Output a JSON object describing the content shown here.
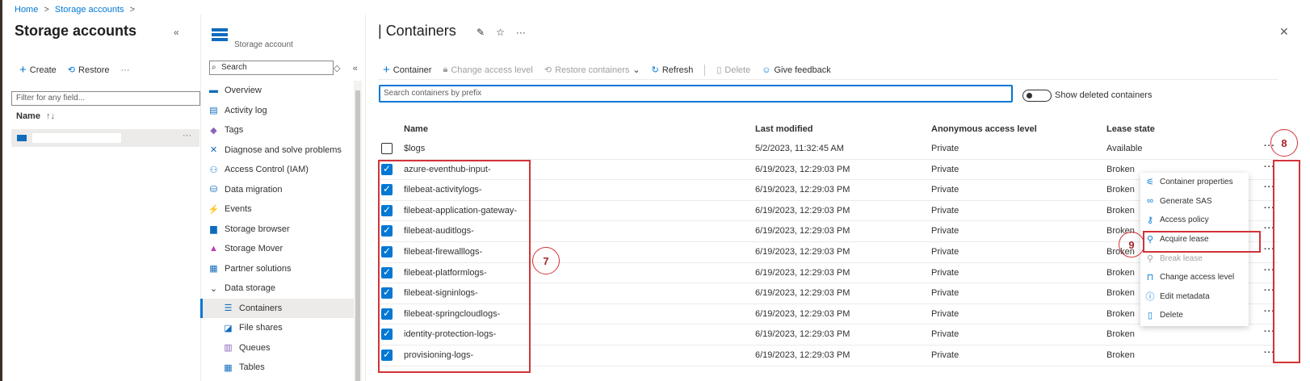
{
  "breadcrumb": {
    "home": "Home",
    "sep": ">",
    "storage": "Storage accounts"
  },
  "left_pane": {
    "title": "Storage accounts",
    "collapse": "«",
    "create": "Create",
    "restore": "Restore",
    "more": "···",
    "filter_placeholder": "Filter for any field...",
    "name_header": "Name",
    "sort": "↑↓",
    "row_dots": "···"
  },
  "resource": {
    "type_label": "Storage account",
    "search_placeholder": "Search"
  },
  "menu": {
    "items": [
      {
        "label": "Overview",
        "icon": "overview-icon"
      },
      {
        "label": "Activity log",
        "icon": "activity-log-icon"
      },
      {
        "label": "Tags",
        "icon": "tag-icon"
      },
      {
        "label": "Diagnose and solve problems",
        "icon": "wrench-icon"
      },
      {
        "label": "Access Control (IAM)",
        "icon": "people-icon"
      },
      {
        "label": "Data migration",
        "icon": "migration-icon"
      },
      {
        "label": "Events",
        "icon": "lightning-icon"
      },
      {
        "label": "Storage browser",
        "icon": "folder-icon"
      },
      {
        "label": "Storage Mover",
        "icon": "mover-icon"
      },
      {
        "label": "Partner solutions",
        "icon": "partner-icon"
      },
      {
        "label": "Data storage",
        "icon": "chevron-down-icon"
      },
      {
        "label": "Containers",
        "icon": "containers-icon"
      },
      {
        "label": "File shares",
        "icon": "file-shares-icon"
      },
      {
        "label": "Queues",
        "icon": "queues-icon"
      },
      {
        "label": "Tables",
        "icon": "tables-icon"
      }
    ]
  },
  "main": {
    "title": "Containers",
    "toolbar": {
      "container": "Container",
      "change_access": "Change access level",
      "restore": "Restore containers",
      "refresh": "Refresh",
      "delete": "Delete",
      "feedback": "Give feedback"
    },
    "search_placeholder": "Search containers by prefix",
    "show_deleted": "Show deleted containers",
    "columns": [
      "Name",
      "Last modified",
      "Anonymous access level",
      "Lease state"
    ],
    "rows": [
      {
        "name": "$logs",
        "modified": "5/2/2023, 11:32:45 AM",
        "access": "Private",
        "lease": "Available",
        "checked": false
      },
      {
        "name": "azure-eventhub-input-",
        "modified": "6/19/2023, 12:29:03 PM",
        "access": "Private",
        "lease": "Broken",
        "checked": true
      },
      {
        "name": "filebeat-activitylogs-",
        "modified": "6/19/2023, 12:29:03 PM",
        "access": "Private",
        "lease": "Broken",
        "checked": true
      },
      {
        "name": "filebeat-application-gateway-",
        "modified": "6/19/2023, 12:29:03 PM",
        "access": "Private",
        "lease": "Broken",
        "checked": true
      },
      {
        "name": "filebeat-auditlogs-",
        "modified": "6/19/2023, 12:29:03 PM",
        "access": "Private",
        "lease": "Broken",
        "checked": true
      },
      {
        "name": "filebeat-firewalllogs-",
        "modified": "6/19/2023, 12:29:03 PM",
        "access": "Private",
        "lease": "Broken",
        "checked": true
      },
      {
        "name": "filebeat-platformlogs-",
        "modified": "6/19/2023, 12:29:03 PM",
        "access": "Private",
        "lease": "Broken",
        "checked": true
      },
      {
        "name": "filebeat-signinlogs-",
        "modified": "6/19/2023, 12:29:03 PM",
        "access": "Private",
        "lease": "Broken",
        "checked": true
      },
      {
        "name": "filebeat-springcloudlogs-",
        "modified": "6/19/2023, 12:29:03 PM",
        "access": "Private",
        "lease": "Broken",
        "checked": true
      },
      {
        "name": "identity-protection-logs-",
        "modified": "6/19/2023, 12:29:03 PM",
        "access": "Private",
        "lease": "Broken",
        "checked": true
      },
      {
        "name": "provisioning-logs-",
        "modified": "6/19/2023, 12:29:03 PM",
        "access": "Private",
        "lease": "Broken",
        "checked": true
      }
    ],
    "row_dots": "···"
  },
  "context_menu": [
    {
      "label": "Container properties",
      "icon": "properties-icon",
      "disabled": false
    },
    {
      "label": "Generate SAS",
      "icon": "link-icon",
      "disabled": false
    },
    {
      "label": "Access policy",
      "icon": "key-icon",
      "disabled": false
    },
    {
      "label": "Acquire lease",
      "icon": "lease-icon",
      "disabled": false
    },
    {
      "label": "Break lease",
      "icon": "break-lease-icon",
      "disabled": true
    },
    {
      "label": "Change access level",
      "icon": "lock-icon",
      "disabled": false
    },
    {
      "label": "Edit metadata",
      "icon": "info-icon",
      "disabled": false
    },
    {
      "label": "Delete",
      "icon": "trash-icon",
      "disabled": false
    }
  ],
  "callouts": {
    "c7": "7",
    "c8": "8",
    "c9": "9"
  },
  "colors": {
    "accent": "#0078d4",
    "annotation_red": "#d13438"
  }
}
